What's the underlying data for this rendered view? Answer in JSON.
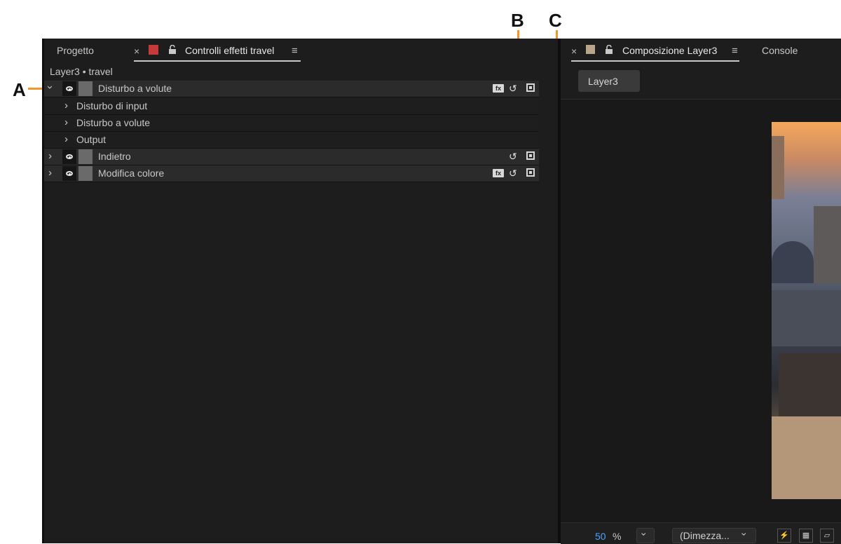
{
  "callouts": {
    "a": "A",
    "b": "B",
    "c": "C"
  },
  "left_panel": {
    "tabs": [
      {
        "label": "Progetto"
      },
      {
        "label": "Controlli effetti travel",
        "active": true
      }
    ],
    "close_glyph": "×",
    "menu_glyph": "≡",
    "layer_header": "Layer3 • travel",
    "effects": [
      {
        "name": "Disturbo a volute",
        "expanded": true,
        "params": [
          "Disturbo di input",
          "Disturbo a volute",
          "Output"
        ]
      },
      {
        "name": "Indietro",
        "expanded": false
      },
      {
        "name": "Modifica colore",
        "expanded": false
      }
    ]
  },
  "right_panel": {
    "tabs": [
      {
        "label": "Composizione Layer3",
        "active": true
      },
      {
        "label": "Console"
      }
    ],
    "close_glyph": "×",
    "menu_glyph": "≡",
    "viewer_tab": "Layer3",
    "zoom_value": "50",
    "zoom_unit": "%",
    "resolution": "(Dimezza..."
  },
  "colors": {
    "callout_line": "#f0962a",
    "label_red": "#c73a3a",
    "label_tan": "#b9a58a",
    "zoom_accent": "#4aa3ff"
  },
  "icons": [
    "eye-icon",
    "chevron-right-icon",
    "chevron-down-icon",
    "reset-icon",
    "fx-icon",
    "target-icon",
    "lock-icon",
    "menu-icon",
    "close-icon"
  ]
}
